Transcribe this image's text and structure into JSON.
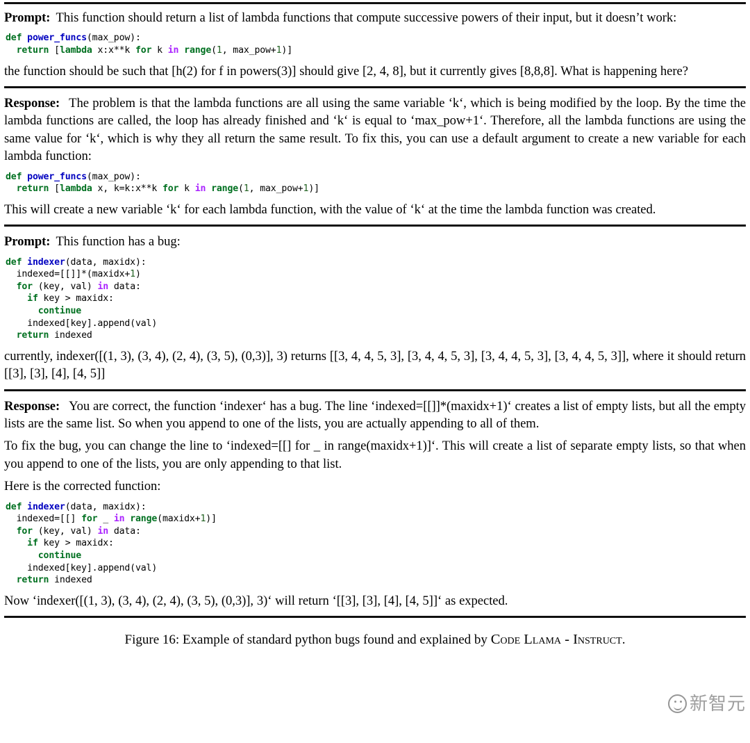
{
  "document": {
    "labels": {
      "prompt": "Prompt:",
      "response": "Response:"
    },
    "sections": [
      {
        "kind": "prompt",
        "intro": "This function should return a list of lambda functions that compute successive powers of their input, but it doesn’t work:",
        "code_after": "the function should be such that [h(2) for f in powers(3)] should give [2, 4, 8], but it currently gives [8,8,8]. What is happening here?"
      },
      {
        "kind": "response",
        "para1": "The problem is that the lambda functions are all using the same variable ‘k‘, which is being modified by the loop. By the time the lambda functions are called, the loop has already finished and ‘k‘ is equal to ‘max_pow+1‘. Therefore, all the lambda functions are using the same value for ‘k‘, which is why they all return the same result. To fix this, you can use a default argument to create a new variable for each lambda function:",
        "para2": "This will create a new variable ‘k‘ for each lambda function, with the value of ‘k‘ at the time the lambda function was created."
      },
      {
        "kind": "prompt",
        "intro": "This function has a bug:",
        "code_after": "currently, indexer([(1, 3), (3, 4), (2, 4), (3, 5), (0,3)], 3) returns [[3, 4, 4, 5, 3], [3, 4, 4, 5, 3], [3, 4, 4, 5, 3], [3, 4, 4, 5, 3]], where it should return [[3], [3], [4], [4, 5]]"
      },
      {
        "kind": "response",
        "para1": "You are correct, the function ‘indexer‘ has a bug. The line ‘indexed=[[]]*(maxidx+1)‘ creates a list of empty lists, but all the empty lists are the same list. So when you append to one of the lists, you are actually appending to all of them.",
        "para2": "To fix the bug, you can change the line to ‘indexed=[[] for _ in range(maxidx+1)]‘. This will create a list of separate empty lists, so that when you append to one of the lists, you are only appending to that list.",
        "para3": "Here is the corrected function:",
        "para4": "Now ‘indexer([(1, 3), (3, 4), (2, 4), (3, 5), (0,3)], 3)‘ will return ‘[[3], [3], [4], [4, 5]]‘ as expected."
      }
    ],
    "code_blocks": {
      "buggy_powers": {
        "lines": [
          [
            {
              "t": "def",
              "c": "k"
            },
            {
              "t": " ",
              "c": ""
            },
            {
              "t": "power_funcs",
              "c": "nf"
            },
            {
              "t": "(max_pow):",
              "c": ""
            }
          ],
          [
            {
              "t": "  ",
              "c": ""
            },
            {
              "t": "return",
              "c": "k"
            },
            {
              "t": " [",
              "c": ""
            },
            {
              "t": "lambda",
              "c": "k"
            },
            {
              "t": " x:x**k ",
              "c": ""
            },
            {
              "t": "for",
              "c": "k"
            },
            {
              "t": " k ",
              "c": ""
            },
            {
              "t": "in",
              "c": "ow"
            },
            {
              "t": " ",
              "c": ""
            },
            {
              "t": "range",
              "c": "kb"
            },
            {
              "t": "(",
              "c": ""
            },
            {
              "t": "1",
              "c": "mi"
            },
            {
              "t": ", max_pow+",
              "c": ""
            },
            {
              "t": "1",
              "c": "mi"
            },
            {
              "t": ")]",
              "c": ""
            }
          ]
        ]
      },
      "fixed_powers": {
        "lines": [
          [
            {
              "t": "def",
              "c": "k"
            },
            {
              "t": " ",
              "c": ""
            },
            {
              "t": "power_funcs",
              "c": "nf"
            },
            {
              "t": "(max_pow):",
              "c": ""
            }
          ],
          [
            {
              "t": "  ",
              "c": ""
            },
            {
              "t": "return",
              "c": "k"
            },
            {
              "t": " [",
              "c": ""
            },
            {
              "t": "lambda",
              "c": "k"
            },
            {
              "t": " x, k=k:x**k ",
              "c": ""
            },
            {
              "t": "for",
              "c": "k"
            },
            {
              "t": " k ",
              "c": ""
            },
            {
              "t": "in",
              "c": "ow"
            },
            {
              "t": " ",
              "c": ""
            },
            {
              "t": "range",
              "c": "kb"
            },
            {
              "t": "(",
              "c": ""
            },
            {
              "t": "1",
              "c": "mi"
            },
            {
              "t": ", max_pow+",
              "c": ""
            },
            {
              "t": "1",
              "c": "mi"
            },
            {
              "t": ")]",
              "c": ""
            }
          ]
        ]
      },
      "buggy_indexer": {
        "lines": [
          [
            {
              "t": "def",
              "c": "k"
            },
            {
              "t": " ",
              "c": ""
            },
            {
              "t": "indexer",
              "c": "nf"
            },
            {
              "t": "(data, maxidx):",
              "c": ""
            }
          ],
          [
            {
              "t": "  indexed=[[]]*(maxidx+",
              "c": ""
            },
            {
              "t": "1",
              "c": "mi"
            },
            {
              "t": ")",
              "c": ""
            }
          ],
          [
            {
              "t": "  ",
              "c": ""
            },
            {
              "t": "for",
              "c": "k"
            },
            {
              "t": " (key, val) ",
              "c": ""
            },
            {
              "t": "in",
              "c": "ow"
            },
            {
              "t": " data:",
              "c": ""
            }
          ],
          [
            {
              "t": "    ",
              "c": ""
            },
            {
              "t": "if",
              "c": "k"
            },
            {
              "t": " key > maxidx:",
              "c": ""
            }
          ],
          [
            {
              "t": "      ",
              "c": ""
            },
            {
              "t": "continue",
              "c": "k"
            }
          ],
          [
            {
              "t": "    indexed[key].append(val)",
              "c": ""
            }
          ],
          [
            {
              "t": "  ",
              "c": ""
            },
            {
              "t": "return",
              "c": "k"
            },
            {
              "t": " indexed",
              "c": ""
            }
          ]
        ]
      },
      "fixed_indexer": {
        "lines": [
          [
            {
              "t": "def",
              "c": "k"
            },
            {
              "t": " ",
              "c": ""
            },
            {
              "t": "indexer",
              "c": "nf"
            },
            {
              "t": "(data, maxidx):",
              "c": ""
            }
          ],
          [
            {
              "t": "  indexed=[[] ",
              "c": ""
            },
            {
              "t": "for",
              "c": "k"
            },
            {
              "t": " _ ",
              "c": ""
            },
            {
              "t": "in",
              "c": "ow"
            },
            {
              "t": " ",
              "c": ""
            },
            {
              "t": "range",
              "c": "kb"
            },
            {
              "t": "(maxidx+",
              "c": ""
            },
            {
              "t": "1",
              "c": "mi"
            },
            {
              "t": ")]",
              "c": ""
            }
          ],
          [
            {
              "t": "  ",
              "c": ""
            },
            {
              "t": "for",
              "c": "k"
            },
            {
              "t": " (key, val) ",
              "c": ""
            },
            {
              "t": "in",
              "c": "ow"
            },
            {
              "t": " data:",
              "c": ""
            }
          ],
          [
            {
              "t": "    ",
              "c": ""
            },
            {
              "t": "if",
              "c": "k"
            },
            {
              "t": " key > maxidx:",
              "c": ""
            }
          ],
          [
            {
              "t": "      ",
              "c": ""
            },
            {
              "t": "continue",
              "c": "k"
            }
          ],
          [
            {
              "t": "    indexed[key].append(val)",
              "c": ""
            }
          ],
          [
            {
              "t": "  ",
              "c": ""
            },
            {
              "t": "return",
              "c": "k"
            },
            {
              "t": " indexed",
              "c": ""
            }
          ]
        ]
      }
    },
    "caption": {
      "prefix": "Figure 16: Example of standard python bugs found and explained by ",
      "model": "Code Llama - Instruct",
      "suffix": "."
    },
    "watermark": {
      "text": "新智元",
      "icon": "wechat-face-icon"
    },
    "colors": {
      "keyword": "#007020",
      "function_name": "#0000c0",
      "operator_word": "#aa22ff",
      "number": "#206020",
      "rule": "#101010",
      "watermark": "#7a7a7a"
    }
  }
}
